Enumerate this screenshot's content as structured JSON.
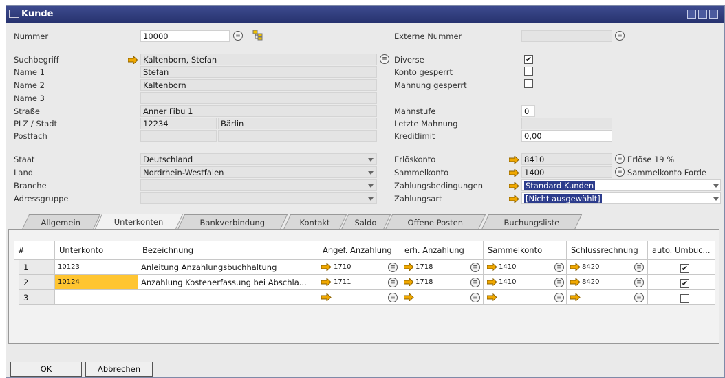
{
  "window": {
    "title": "Kunde"
  },
  "header": {
    "nummer_label": "Nummer",
    "nummer_value": "10000",
    "suchbegriff_label": "Suchbegriff",
    "suchbegriff_value": "Kaltenborn, Stefan",
    "name1_label": "Name 1",
    "name1_value": "Stefan",
    "name2_label": "Name 2",
    "name2_value": "Kaltenborn",
    "name3_label": "Name 3",
    "name3_value": "",
    "strasse_label": "Straße",
    "strasse_value": "Anner Fibu 1",
    "plzstadt_label": "PLZ / Stadt",
    "plz_value": "12234",
    "stadt_value": "Bärlin",
    "postfach_label": "Postfach",
    "postfach_value": "",
    "staat_label": "Staat",
    "staat_value": "Deutschland",
    "land_label": "Land",
    "land_value": "Nordrhein-Westfalen",
    "branche_label": "Branche",
    "branche_value": "",
    "adressgruppe_label": "Adressgruppe",
    "adressgruppe_value": ""
  },
  "right": {
    "externe_label": "Externe Nummer",
    "externe_value": "",
    "diverse_label": "Diverse",
    "diverse_checked": true,
    "konto_gesperrt_label": "Konto gesperrt",
    "konto_gesperrt_checked": false,
    "mahnung_gesperrt_label": "Mahnung gesperrt",
    "mahnung_gesperrt_checked": false,
    "mahnstufe_label": "Mahnstufe",
    "mahnstufe_value": "0",
    "letzte_mahnung_label": "Letzte Mahnung",
    "letzte_mahnung_value": "",
    "kreditlimit_label": "Kreditlimit",
    "kreditlimit_value": "0,00",
    "erloeskonto_label": "Erlöskonto",
    "erloeskonto_value": "8410",
    "erloeskonto_desc": "Erlöse 19 %",
    "sammelkonto_label": "Sammelkonto",
    "sammelkonto_value": "1400",
    "sammelkonto_desc": "Sammelkonto Forde",
    "zahlungsbed_label": "Zahlungsbedingungen",
    "zahlungsbed_value": "Standard Kunden",
    "zahlungsart_label": "Zahlungsart",
    "zahlungsart_value": "[Nicht ausgewählt]"
  },
  "tabs": [
    "Allgemein",
    "Unterkonten",
    "Bankverbindung",
    "Kontakt",
    "Saldo",
    "Offene Posten",
    "Buchungsliste"
  ],
  "active_tab": "Unterkonten",
  "grid": {
    "headers": [
      "#",
      "Unterkonto",
      "Bezeichnung",
      "Angef. Anzahlung",
      "erh. Anzahlung",
      "Sammelkonto",
      "Schlussrechnung",
      "auto. Umbuc..."
    ],
    "rows": [
      {
        "n": "1",
        "unterkonto": "10123",
        "bez": "Anleitung Anzahlungsbuchhaltung",
        "angef": "1710",
        "erh": "1718",
        "sammel": "1410",
        "schluss": "8420",
        "auto": true
      },
      {
        "n": "2",
        "unterkonto": "10124",
        "bez": "Anzahlung Kostenerfassung bei Abschla...",
        "angef": "1711",
        "erh": "1718",
        "sammel": "1410",
        "schluss": "8420",
        "auto": true
      },
      {
        "n": "3",
        "unterkonto": "",
        "bez": "",
        "angef": "",
        "erh": "",
        "sammel": "",
        "schluss": "",
        "auto": false
      }
    ]
  },
  "buttons": {
    "ok": "OK",
    "cancel": "Abbrechen"
  },
  "colors": {
    "title_bar": "#2f3b7e",
    "selection": "#2c3c8c",
    "active_cell": "#ffc531",
    "arrow": "#f0a800"
  }
}
